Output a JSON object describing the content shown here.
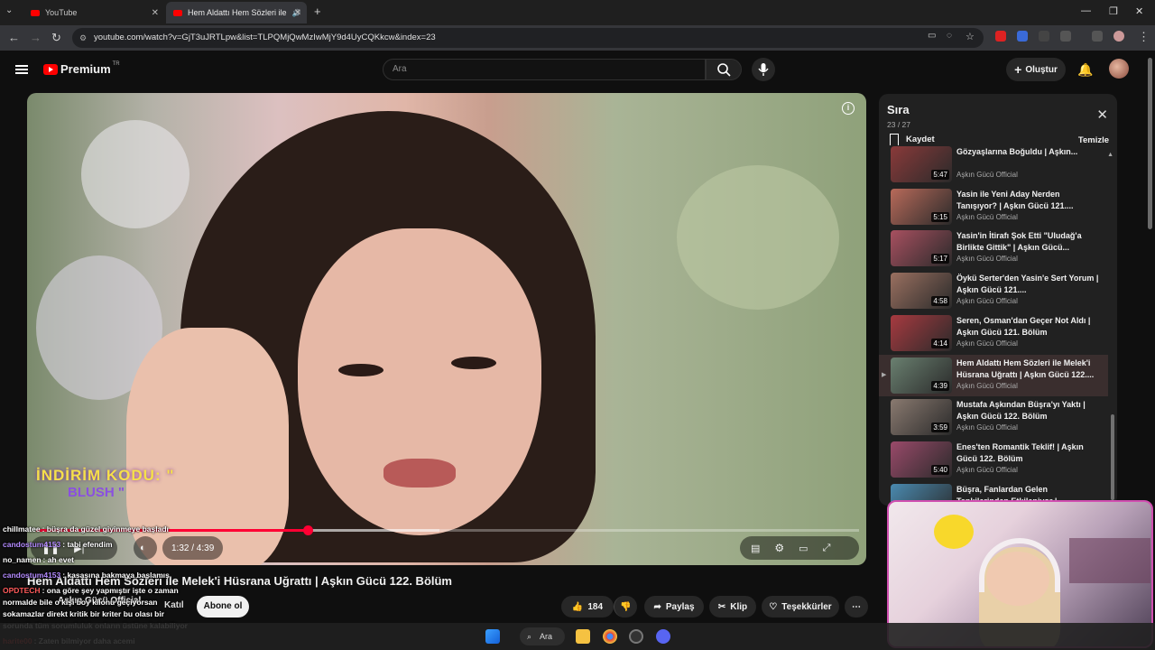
{
  "browser": {
    "tabs": [
      {
        "label": "YouTube",
        "active": false
      },
      {
        "label": "Hem Aldattı Hem Sözleri ile",
        "active": true
      }
    ],
    "url": "youtube.com/watch?v=GjT3uJRTLpw&list=TLPQMjQwMzIwMjY9d4UyCQKkcw&index=23"
  },
  "header": {
    "logo_text": "Premium",
    "logo_region": "TR",
    "search_placeholder": "Ara",
    "create_label": "Oluştur"
  },
  "player": {
    "time": "1:32 / 4:39",
    "progress_fraction": 0.33,
    "buffer_fraction": 0.49,
    "promo_line1": "İNDİRİM KODU: \"",
    "promo_line2": "BLUSH \""
  },
  "video": {
    "title": "Hem Aldattı Hem Sözleri ile Melek'i Hüsrana Uğrattı | Aşkın Gücü 122. Bölüm",
    "channel": "Aşkın Gücü Official",
    "join_label": "Katıl",
    "subscribe_label": "Abone ol",
    "likes": "184",
    "share_label": "Paylaş",
    "clip_label": "Klip",
    "thanks_label": "Teşekkürler"
  },
  "chat": [
    {
      "user": "chillmatee",
      "msg": ": büşra da güzel giyinmeye başladı",
      "color": "#ffffff"
    },
    {
      "user": "candostum4153",
      "msg": ": tabi efendim",
      "color": "#b48bff"
    },
    {
      "user": "no_namen",
      "msg": ": ah evet",
      "color": "#ffffff"
    },
    {
      "user": "candostum4153",
      "msg": ": kasasına bakmaya başlamış",
      "color": "#b48bff"
    },
    {
      "user": "OPDTECH",
      "msg": ": ona göre şey yapmıştır işte o zaman",
      "color": "#ff5a5a"
    },
    {
      "user": "",
      "msg": "normalde bile o kişi boy kilonu geçiyorsan",
      "color": "#ffffff"
    },
    {
      "user": "",
      "msg": "sokamazlar direkt kritik bir kriter bu olası bir",
      "color": "#ffffff"
    },
    {
      "user": "",
      "msg": "sorunda tüm sorumluluk onların üstüne kalabiliyor",
      "color": "#ffffff"
    },
    {
      "user": "harite00",
      "msg": ": Zaten bilmiyor daha acemi",
      "color": "#ff4040"
    }
  ],
  "queue": {
    "title": "Sıra",
    "position": "23 / 27",
    "save_label": "Kaydet",
    "clear_label": "Temizle",
    "items": [
      {
        "title": "Gözyaşlarına Boğuldu | Aşkın...",
        "title_pre": "Arkadaşlığını Öğrenen Melek",
        "duration": "5:47",
        "channel": "Aşkın Gücü Official",
        "active": false,
        "color": "#8a3a3a"
      },
      {
        "title": "Yasin ile Yeni Aday Nerden Tanışıyor? | Aşkın Gücü 121....",
        "duration": "5:15",
        "channel": "Aşkın Gücü Official",
        "active": false,
        "color": "#b86a5a"
      },
      {
        "title": "Yasin'in İtirafı Şok Etti \"Uludağ'a Birlikte Gittik\" | Aşkın Gücü...",
        "duration": "5:17",
        "channel": "Aşkın Gücü Official",
        "active": false,
        "color": "#a85060"
      },
      {
        "title": "Öykü Serter'den Yasin'e Sert Yorum | Aşkın Gücü 121....",
        "duration": "4:58",
        "channel": "Aşkın Gücü Official",
        "active": false,
        "color": "#9a7060"
      },
      {
        "title": "Seren, Osman'dan Geçer Not Aldı | Aşkın Gücü 121. Bölüm",
        "duration": "4:14",
        "channel": "Aşkın Gücü Official",
        "active": false,
        "color": "#a83a40"
      },
      {
        "title": "Hem Aldattı Hem Sözleri ile Melek'i Hüsrana Uğrattı | Aşkın Gücü 122....",
        "duration": "4:39",
        "channel": "Aşkın Gücü Official",
        "active": true,
        "color": "#6a8070"
      },
      {
        "title": "Mustafa Aşkından Büşra'yı Yaktı | Aşkın Gücü 122. Bölüm",
        "duration": "3:59",
        "channel": "Aşkın Gücü Official",
        "active": false,
        "color": "#8a7a70"
      },
      {
        "title": "Enes'ten Romantik Teklif! | Aşkın Gücü 122. Bölüm",
        "duration": "5:40",
        "channel": "Aşkın Gücü Official",
        "active": false,
        "color": "#9a4a6a"
      },
      {
        "title": "Büşra, Fanlardan Gelen Tepkilerinden Etkileniyor |",
        "duration": "",
        "channel": "",
        "active": false,
        "color": "#4a8ab0"
      }
    ]
  },
  "taskbar": {
    "search_label": "Ara"
  },
  "colors": {
    "accent_red": "#ff0033",
    "background": "#0f0f0f",
    "panel": "#212121"
  }
}
